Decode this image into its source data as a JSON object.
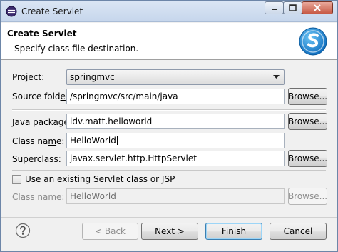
{
  "window": {
    "title": "Create Servlet",
    "controls": {
      "minimize": "minimize-icon",
      "maximize": "maximize-icon",
      "close": "close-icon"
    }
  },
  "banner": {
    "title": "Create Servlet",
    "description": "Specify class file destination."
  },
  "form": {
    "project": {
      "label_pre": "",
      "label_key": "P",
      "label_post": "roject:",
      "value": "springmvc"
    },
    "source_folder": {
      "label_pre": "Source fold",
      "label_key": "e",
      "label_post": "r:",
      "value": "/springmvc/src/main/java",
      "browse": "Browse..."
    },
    "java_package": {
      "label_pre": "Java pac",
      "label_key": "k",
      "label_post": "age:",
      "value": "idv.matt.helloworld",
      "browse": "Browse..."
    },
    "class_name": {
      "label_pre": "Class na",
      "label_key": "m",
      "label_post": "e:",
      "value": "HelloWorld"
    },
    "superclass": {
      "label_pre": "",
      "label_key": "S",
      "label_post": "uperclass:",
      "value": "javax.servlet.http.HttpServlet",
      "browse": "Browse..."
    },
    "use_existing": {
      "label_pre": "",
      "label_key": "U",
      "label_post": "se an existing Servlet class or JSP",
      "checked": false
    },
    "existing_class": {
      "label_pre": "Class na",
      "label_key": "m",
      "label_post": "e:",
      "value": "HelloWorld",
      "browse": "Browse..."
    }
  },
  "footer": {
    "back": "< Back",
    "next": "Next >",
    "finish": "Finish",
    "cancel": "Cancel"
  },
  "colors": {
    "title_gradient_top": "#dbe6f4",
    "logo_blue": "#1e8ad6",
    "default_button_border": "#3c7fb1"
  }
}
